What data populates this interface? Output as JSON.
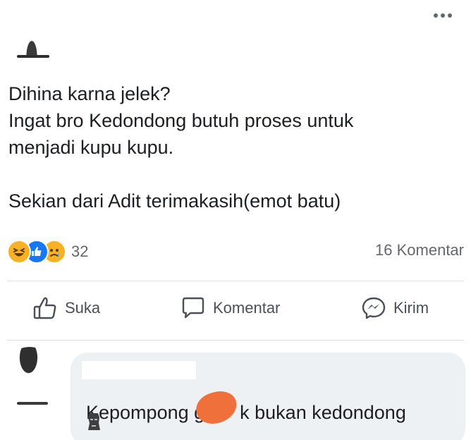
{
  "post": {
    "lines": [
      "Dihina karna jelek?",
      "Ingat bro Kedondong butuh proses untuk",
      "menjadi kupu kupu.",
      "Sekian dari Adit terimakasih(emot batu)"
    ]
  },
  "stats": {
    "reaction_count": "32",
    "comment_count": "16 Komentar"
  },
  "actions": {
    "like_label": "Suka",
    "comment_label": "Komentar",
    "send_label": "Kirim"
  },
  "comment": {
    "text_before_censor": "Kepompong g",
    "text_after_censor": "k bukan kedondong"
  },
  "icons": {
    "more": "more-options-icon",
    "reactions": [
      "haha-reaction-icon",
      "like-reaction-icon",
      "sad-reaction-icon"
    ],
    "like": "thumbs-up-icon",
    "comment": "comment-bubble-icon",
    "send": "messenger-icon",
    "emoji": "moai-emoji-icon"
  },
  "colors": {
    "text": "#1c1e21",
    "secondary_text": "#65676b",
    "like_blue": "#1877f2",
    "reaction_yellow": "#f7b125",
    "censor_orange": "#f0703c",
    "comment_bubble": "#eef1f4"
  }
}
